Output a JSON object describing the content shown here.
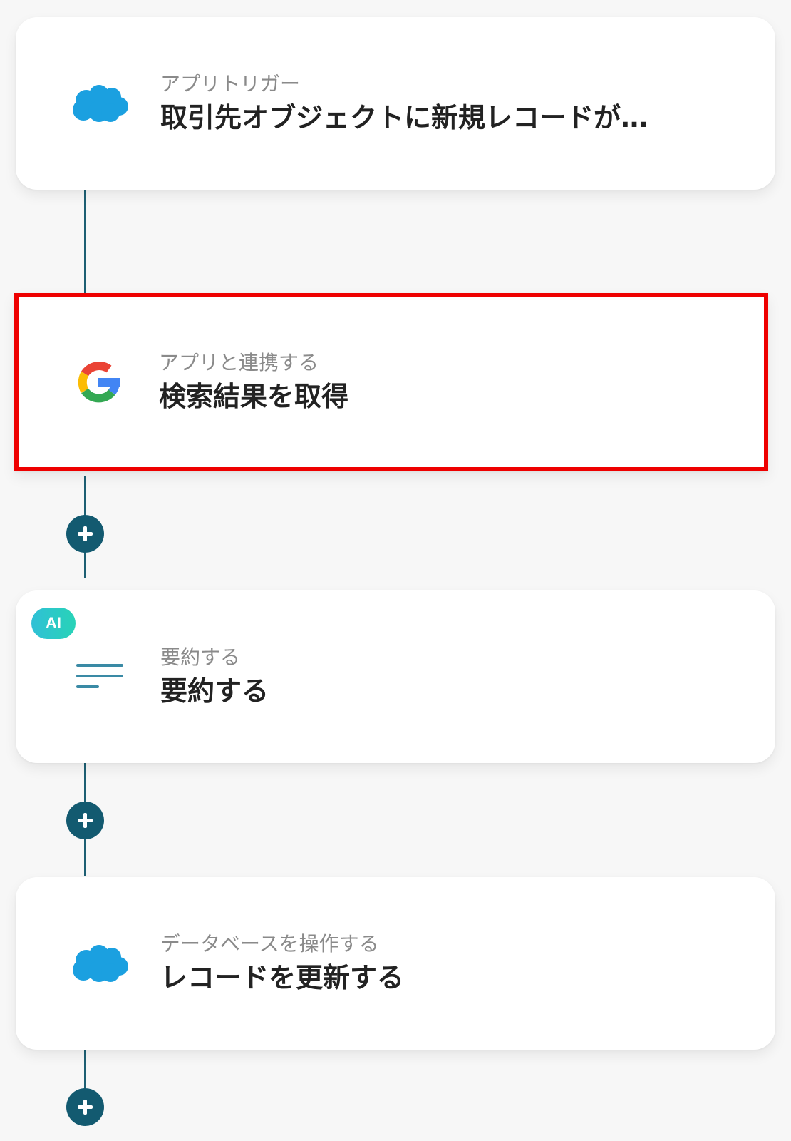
{
  "colors": {
    "background": "#f7f7f7",
    "connector": "#1d5f73",
    "add_button": "#135a70",
    "selection_outline": "#ee0000",
    "salesforce_blue": "#1ba0e0",
    "ai_badge": "#2fc0d6"
  },
  "steps": [
    {
      "icon": "salesforce-cloud-icon",
      "subtitle": "アプリトリガー",
      "title": "取引先オブジェクトに新規レコードが…"
    },
    {
      "icon": "google-g-icon",
      "subtitle": "アプリと連携する",
      "title": "検索結果を取得",
      "selected": true
    },
    {
      "icon": "summary-lines-icon",
      "badge": "AI",
      "subtitle": "要約する",
      "title": "要約する"
    },
    {
      "icon": "salesforce-cloud-icon",
      "subtitle": "データベースを操作する",
      "title": "レコードを更新する"
    }
  ],
  "add_step_icon": "plus-icon"
}
